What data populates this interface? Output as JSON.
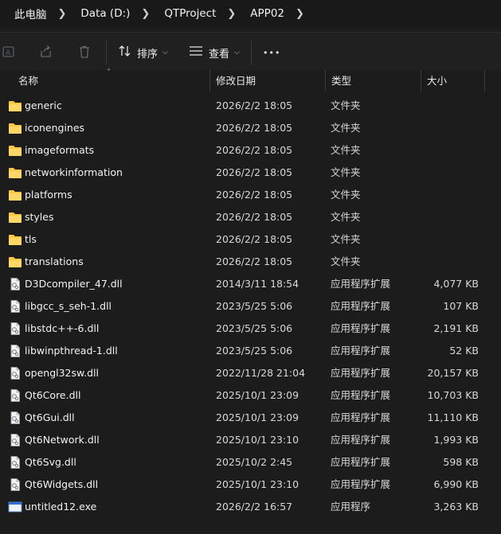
{
  "breadcrumb": [
    "此电脑",
    "Data (D:)",
    "QTProject",
    "APP02"
  ],
  "toolbar": {
    "sort_label": "排序",
    "view_label": "查看",
    "more_label": "•••"
  },
  "columns": {
    "name": "名称",
    "modified": "修改日期",
    "type": "类型",
    "size": "大小"
  },
  "files": [
    {
      "name": "generic",
      "date": "2026/2/2 18:05",
      "type": "文件夹",
      "size": "",
      "kind": "folder"
    },
    {
      "name": "iconengines",
      "date": "2026/2/2 18:05",
      "type": "文件夹",
      "size": "",
      "kind": "folder"
    },
    {
      "name": "imageformats",
      "date": "2026/2/2 18:05",
      "type": "文件夹",
      "size": "",
      "kind": "folder"
    },
    {
      "name": "networkinformation",
      "date": "2026/2/2 18:05",
      "type": "文件夹",
      "size": "",
      "kind": "folder"
    },
    {
      "name": "platforms",
      "date": "2026/2/2 18:05",
      "type": "文件夹",
      "size": "",
      "kind": "folder"
    },
    {
      "name": "styles",
      "date": "2026/2/2 18:05",
      "type": "文件夹",
      "size": "",
      "kind": "folder"
    },
    {
      "name": "tls",
      "date": "2026/2/2 18:05",
      "type": "文件夹",
      "size": "",
      "kind": "folder"
    },
    {
      "name": "translations",
      "date": "2026/2/2 18:05",
      "type": "文件夹",
      "size": "",
      "kind": "folder"
    },
    {
      "name": "D3Dcompiler_47.dll",
      "date": "2014/3/11 18:54",
      "type": "应用程序扩展",
      "size": "4,077 KB",
      "kind": "dll"
    },
    {
      "name": "libgcc_s_seh-1.dll",
      "date": "2023/5/25 5:06",
      "type": "应用程序扩展",
      "size": "107 KB",
      "kind": "dll"
    },
    {
      "name": "libstdc++-6.dll",
      "date": "2023/5/25 5:06",
      "type": "应用程序扩展",
      "size": "2,191 KB",
      "kind": "dll"
    },
    {
      "name": "libwinpthread-1.dll",
      "date": "2023/5/25 5:06",
      "type": "应用程序扩展",
      "size": "52 KB",
      "kind": "dll"
    },
    {
      "name": "opengl32sw.dll",
      "date": "2022/11/28 21:04",
      "type": "应用程序扩展",
      "size": "20,157 KB",
      "kind": "dll"
    },
    {
      "name": "Qt6Core.dll",
      "date": "2025/10/1 23:09",
      "type": "应用程序扩展",
      "size": "10,703 KB",
      "kind": "dll"
    },
    {
      "name": "Qt6Gui.dll",
      "date": "2025/10/1 23:09",
      "type": "应用程序扩展",
      "size": "11,110 KB",
      "kind": "dll"
    },
    {
      "name": "Qt6Network.dll",
      "date": "2025/10/1 23:10",
      "type": "应用程序扩展",
      "size": "1,993 KB",
      "kind": "dll"
    },
    {
      "name": "Qt6Svg.dll",
      "date": "2025/10/2 2:45",
      "type": "应用程序扩展",
      "size": "598 KB",
      "kind": "dll"
    },
    {
      "name": "Qt6Widgets.dll",
      "date": "2025/10/1 23:10",
      "type": "应用程序扩展",
      "size": "6,990 KB",
      "kind": "dll"
    },
    {
      "name": "untitled12.exe",
      "date": "2026/2/2 16:57",
      "type": "应用程序",
      "size": "3,263 KB",
      "kind": "exe"
    }
  ],
  "icons": {
    "folder": "folder-icon",
    "dll": "dll-file-icon",
    "exe": "exe-file-icon",
    "breadcrumb_separator": "chevron-right-icon",
    "sort": "sort-icon",
    "view": "view-list-icon",
    "rename": "rename-icon",
    "share": "share-icon",
    "delete": "trash-icon"
  },
  "colors": {
    "folder_yellow": "#f8c842",
    "background": "#1c1c1c",
    "toolbar": "#202020"
  }
}
